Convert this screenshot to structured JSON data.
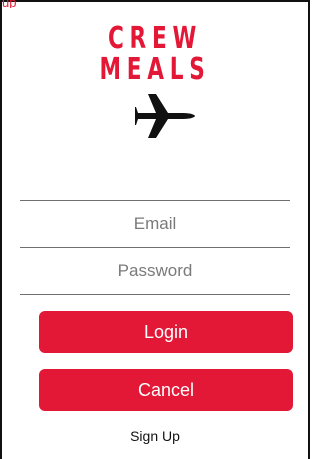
{
  "window": {
    "top_label": "up",
    "background": "#ffffff"
  },
  "brand": {
    "line1": "CREW",
    "line2": "MEALS",
    "color": "#e31837",
    "icon": "airplane-icon"
  },
  "form": {
    "email_placeholder": "Email",
    "password_placeholder": "Password"
  },
  "buttons": {
    "login": "Login",
    "cancel": "Cancel",
    "color": "#e31837"
  },
  "links": {
    "signup": "Sign Up"
  }
}
